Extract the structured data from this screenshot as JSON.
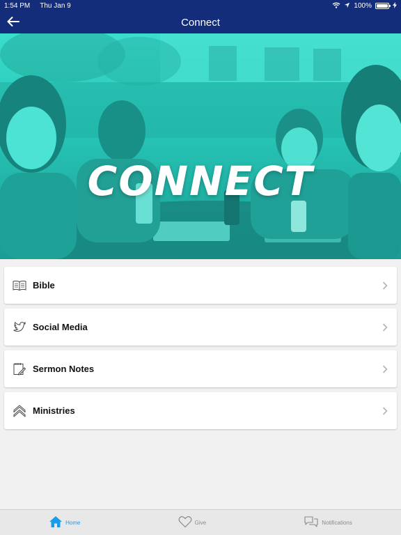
{
  "status_bar": {
    "time": "1:54 PM",
    "date": "Thu Jan 9",
    "battery": "100%",
    "battery_level": 1.0
  },
  "nav": {
    "title": "Connect",
    "back_icon": "arrow-left-icon"
  },
  "hero": {
    "title": "CONNECT"
  },
  "menu": {
    "items": [
      {
        "label": "Bible",
        "icon": "book-icon"
      },
      {
        "label": "Social Media",
        "icon": "twitter-bird-icon"
      },
      {
        "label": "Sermon Notes",
        "icon": "notepad-pen-icon"
      },
      {
        "label": "Ministries",
        "icon": "double-chevron-up-icon"
      }
    ]
  },
  "tabs": [
    {
      "label": "Home",
      "icon": "home-icon",
      "active": true
    },
    {
      "label": "Give",
      "icon": "heart-icon",
      "active": false
    },
    {
      "label": "Notifications",
      "icon": "chat-bubbles-icon",
      "active": false
    }
  ],
  "colors": {
    "nav_background": "#132d7a",
    "hero_tint": "#2fd3c4",
    "active_tab": "#1e9be8",
    "inactive_tab": "#8a8a8a"
  }
}
